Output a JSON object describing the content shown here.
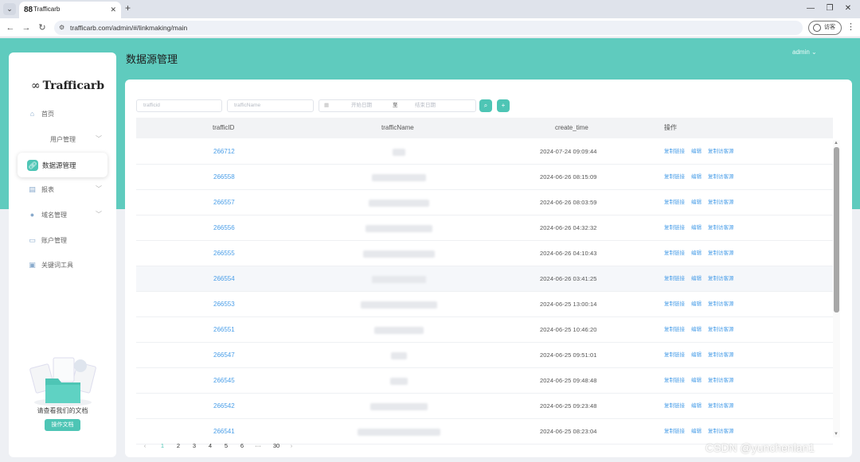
{
  "browser": {
    "tab_title": "Trafficarb",
    "tab_icon": "88",
    "url": "trafficarb.com/admin/#/linkmaking/main",
    "profile_label": "访客"
  },
  "header": {
    "page_title": "数据源管理",
    "user": "admin"
  },
  "sidebar": {
    "logo": "Trafficarb",
    "items": [
      {
        "label": "首页",
        "icon": "home-icon"
      },
      {
        "label": "用户管理",
        "icon": "",
        "chevron": "﹀"
      },
      {
        "label": "数据源管理",
        "icon": "link-icon"
      },
      {
        "label": "报表",
        "icon": "report-icon",
        "chevron": "﹀"
      },
      {
        "label": "域名管理",
        "icon": "user-icon",
        "chevron": "﹀"
      },
      {
        "label": "账户管理",
        "icon": "account-icon"
      },
      {
        "label": "关键词工具",
        "icon": "keyword-icon"
      }
    ],
    "doc_title": "请查看我们的文档",
    "doc_button": "操作文档"
  },
  "filters": {
    "trafficid_placeholder": "trafficid",
    "trafficname_placeholder": "trafficName",
    "start_date_placeholder": "开始日期",
    "date_separator": "至",
    "end_date_placeholder": "结束日期"
  },
  "table": {
    "columns": [
      "trafficID",
      "trafficName",
      "create_time",
      "操作"
    ],
    "actions": [
      "复制链接",
      "编辑",
      "复制访客源"
    ],
    "rows": [
      {
        "id": "266712",
        "time": "2024-07-24 09:09:44"
      },
      {
        "id": "266558",
        "time": "2024-06-26 08:15:09"
      },
      {
        "id": "266557",
        "time": "2024-06-26 08:03:59"
      },
      {
        "id": "266556",
        "time": "2024-06-26 04:32:32"
      },
      {
        "id": "266555",
        "time": "2024-06-26 04:10:43"
      },
      {
        "id": "266554",
        "time": "2024-06-26 03:41:25"
      },
      {
        "id": "266553",
        "time": "2024-06-25 13:00:14"
      },
      {
        "id": "266551",
        "time": "2024-06-25 10:46:20"
      },
      {
        "id": "266547",
        "time": "2024-06-25 09:51:01"
      },
      {
        "id": "266545",
        "time": "2024-06-25 09:48:48"
      },
      {
        "id": "266542",
        "time": "2024-06-25 09:23:48"
      },
      {
        "id": "266541",
        "time": "2024-06-25 08:23:04"
      }
    ]
  },
  "pagination": {
    "prev": "‹",
    "pages": [
      "1",
      "2",
      "3",
      "4",
      "5",
      "6",
      "···",
      "30"
    ],
    "next": "›",
    "current": "1"
  },
  "watermark": "CSDN @yunchenlan1"
}
